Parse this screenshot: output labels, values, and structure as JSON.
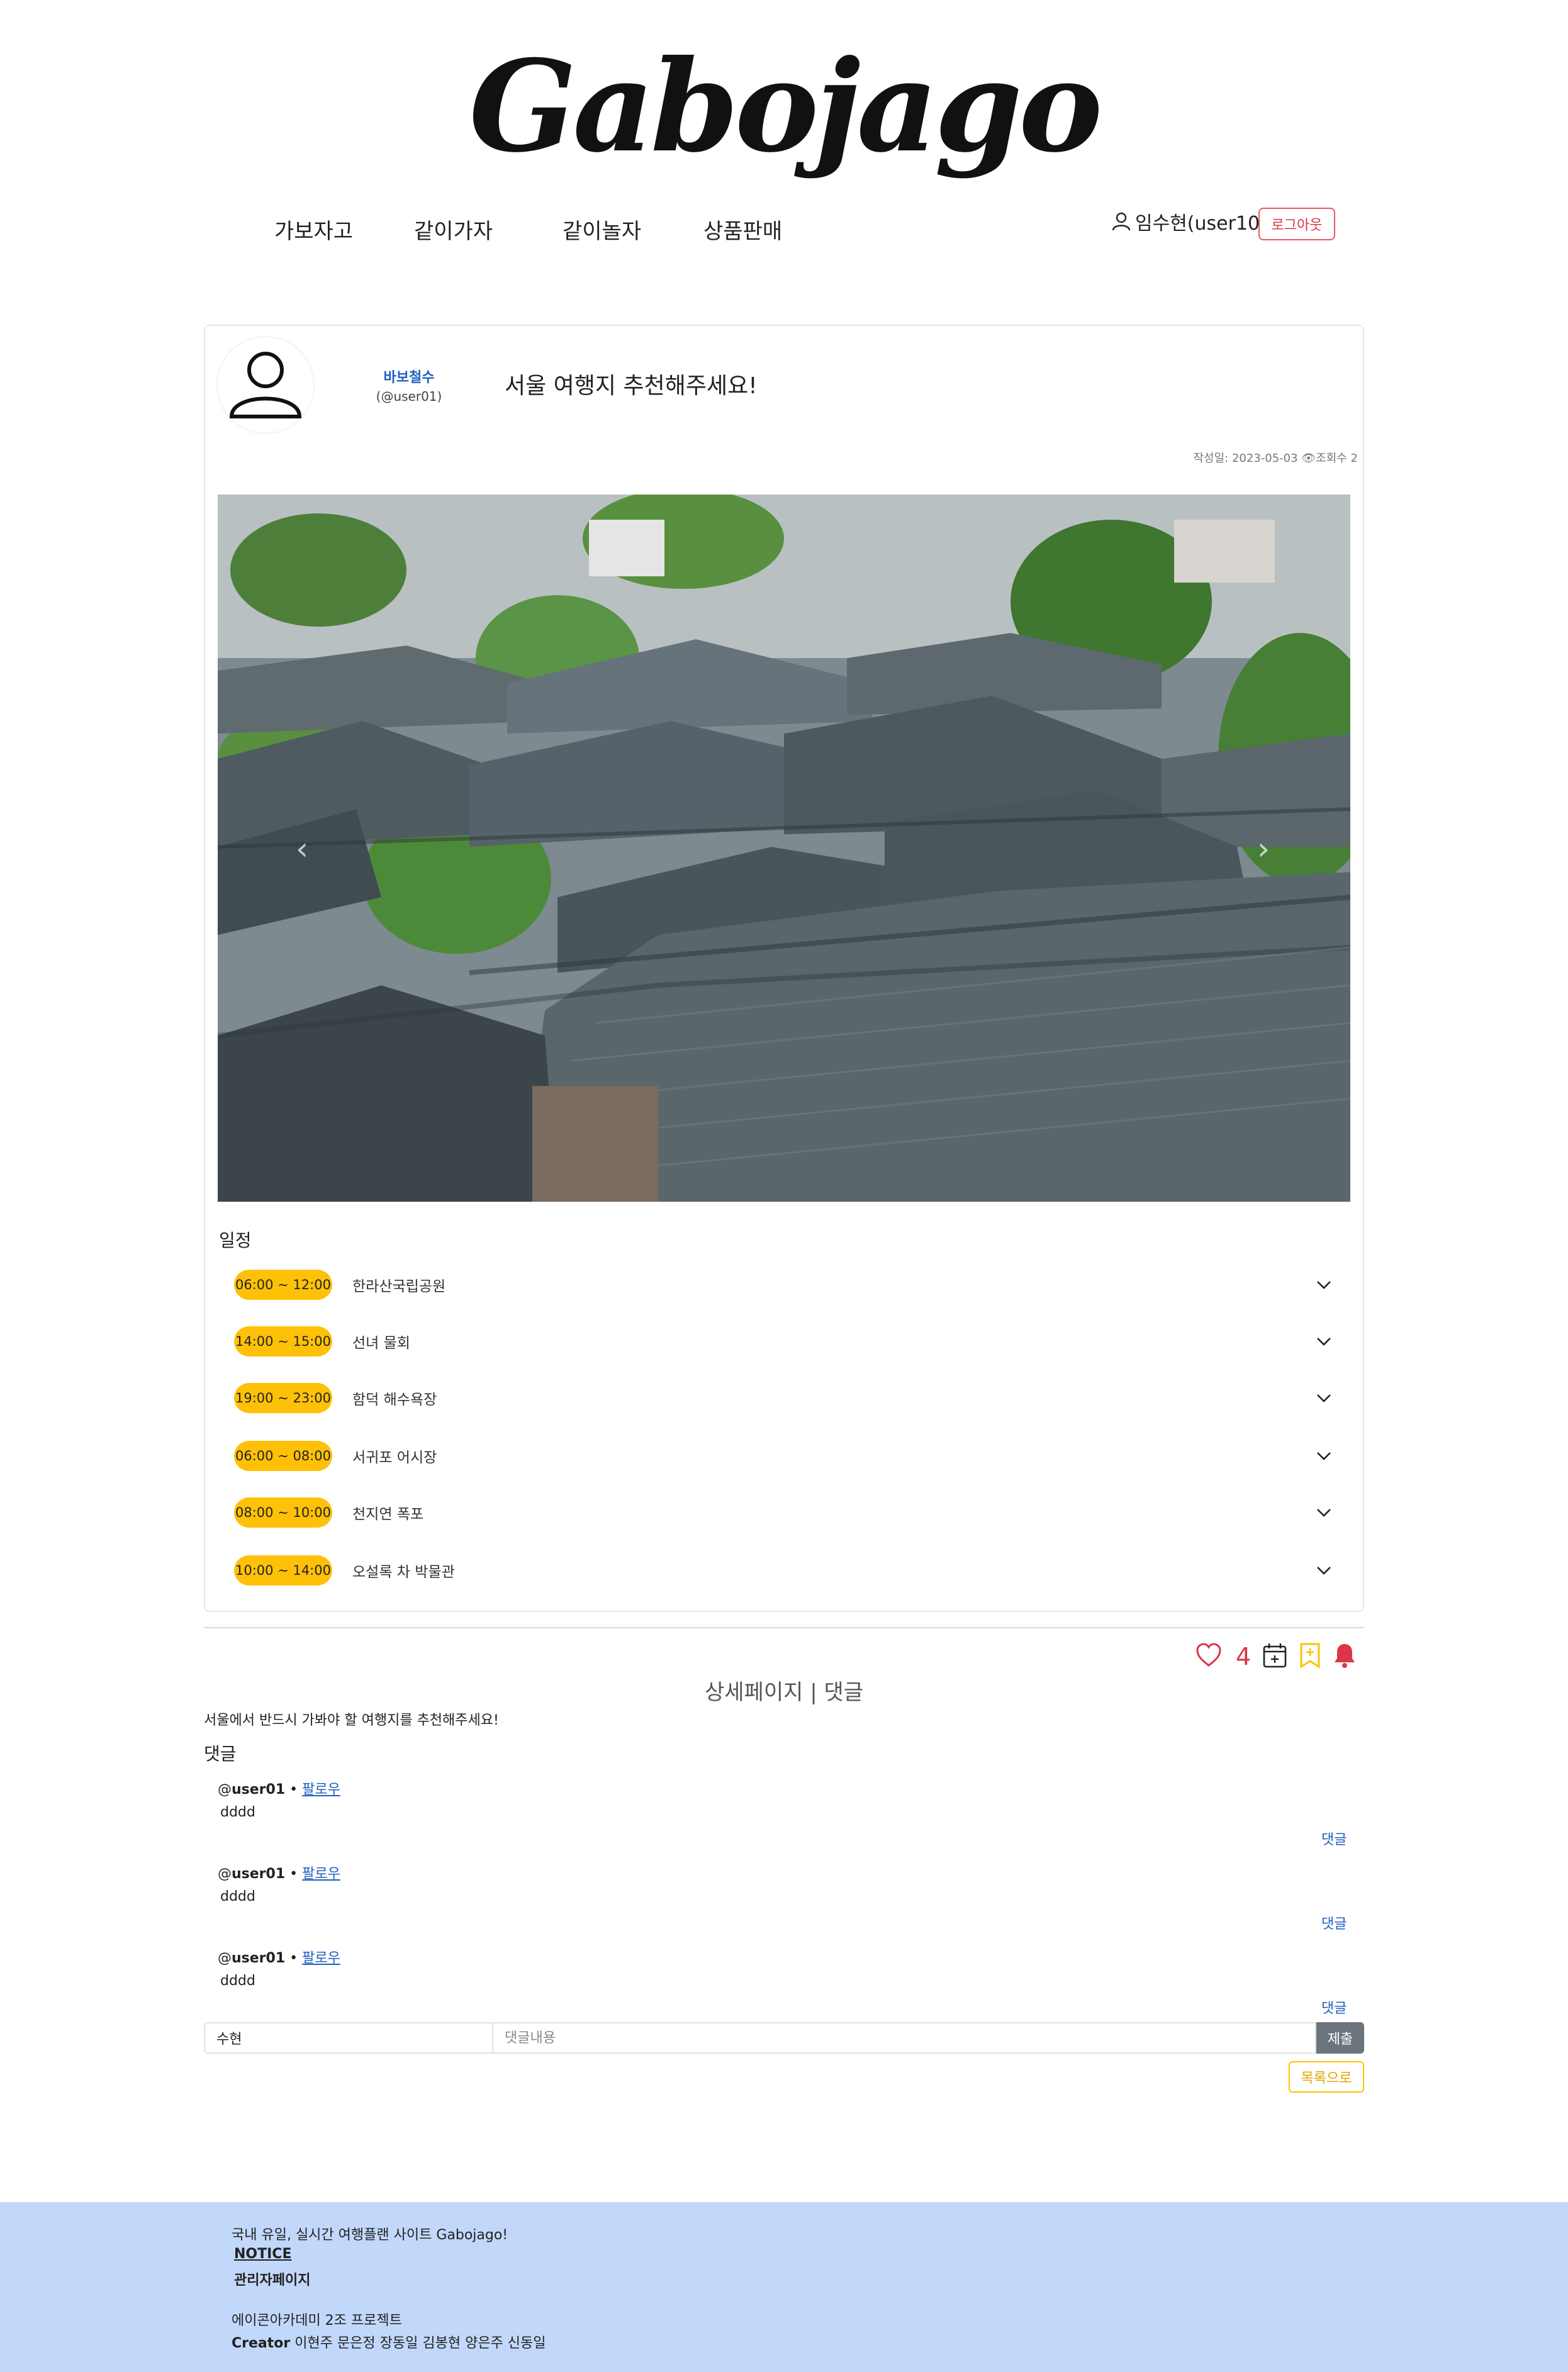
{
  "header": {
    "logo": "Gabojago",
    "nav": [
      "가보자고",
      "같이가자",
      "같이놀자",
      "상품판매"
    ],
    "user_display": "임수현(user10)",
    "logout_label": "로그아웃"
  },
  "post": {
    "author_name": "바보철수",
    "author_handle": "(@user01)",
    "title": "서울 여행지 추천해주세요!",
    "meta": "작성일: 2023-05-03 👁조회수 2",
    "image_alt": "hanok-rooftops-photo",
    "schedule_title": "일정",
    "schedule": [
      {
        "time": "06:00 ~ 12:00",
        "place": "한라산국립공원"
      },
      {
        "time": "14:00 ~ 15:00",
        "place": "선녀 물회"
      },
      {
        "time": "19:00 ~ 23:00",
        "place": "함덕 해수욕장"
      },
      {
        "time": "06:00 ~ 08:00",
        "place": "서귀포 어시장"
      },
      {
        "time": "08:00 ~ 10:00",
        "place": "천지연 폭포"
      },
      {
        "time": "10:00 ~ 14:00",
        "place": "오설록 차 박물관"
      }
    ]
  },
  "actions": {
    "like_count": "4",
    "icons": [
      "heart-icon",
      "calendar-plus-icon",
      "bookmark-plus-icon",
      "bell-icon"
    ],
    "accent_colors": {
      "like": "#dc3545",
      "bookmark": "#ffc107",
      "bell": "#dc3545"
    }
  },
  "detail": {
    "heading": "상세페이지 | 댓글",
    "description": "서울에서 반드시 가봐야 할 여행지를 추천해주세요!",
    "comments_heading": "댓글"
  },
  "comments": [
    {
      "handle_prefix": "@",
      "user": "user01",
      "sep": " • ",
      "follow": "팔로우",
      "body": "dddd",
      "reply": "댓글"
    },
    {
      "handle_prefix": "@",
      "user": "user01",
      "sep": " • ",
      "follow": "팔로우",
      "body": "dddd",
      "reply": "댓글"
    },
    {
      "handle_prefix": "@",
      "user": "user01",
      "sep": " • ",
      "follow": "팔로우",
      "body": "dddd",
      "reply": "댓글"
    }
  ],
  "comment_form": {
    "name_value": "수현",
    "content_placeholder": "댓글내용",
    "submit_label": "제출",
    "back_label": "목록으로"
  },
  "footer": {
    "tagline": "국내 유일, 실시간 여행플랜 사이트 Gabojago!",
    "notice": "NOTICE",
    "admin": "관리자페이지",
    "project": "에이콘아카데미 2조 프로젝트",
    "creator_label": "Creator",
    "creators": " 이현주 문은정 장동일 김봉현 양은주 신동일"
  },
  "colors": {
    "footer_bg": "#c2d8fb",
    "pill": "#ffc107",
    "link": "#1f5fbf"
  }
}
